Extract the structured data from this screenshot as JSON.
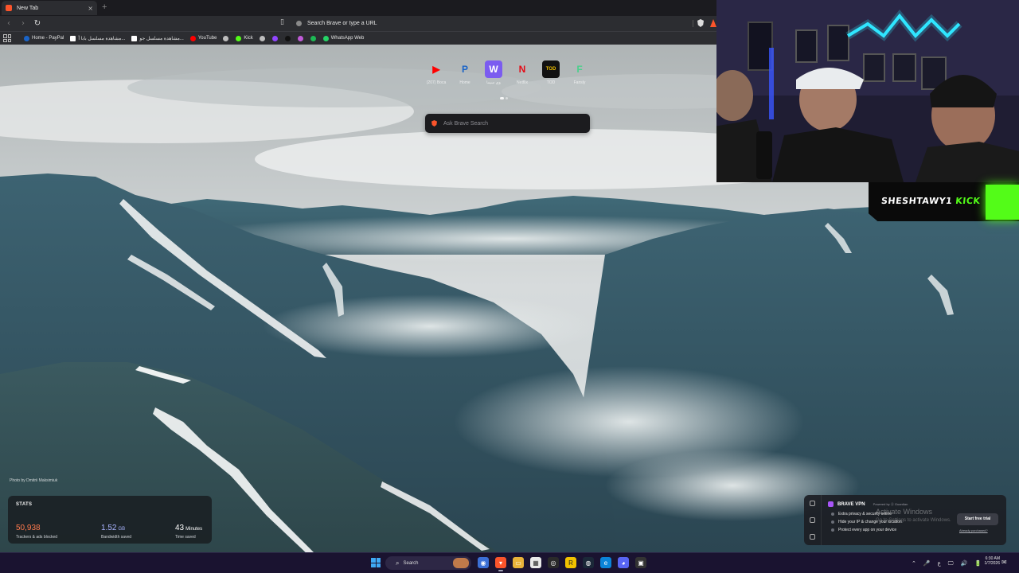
{
  "browser": {
    "tab_title": "New Tab",
    "tab_close": "×",
    "new_tab": "+",
    "back": "‹",
    "forward": "›",
    "reload": "↻",
    "bookmark_glyph": "▯",
    "omnibox_placeholder": "Search Brave or type a URL",
    "bookmarks": [
      {
        "label": "Home - PayPal",
        "icon": "paypal-icon",
        "color": "#1a64c8"
      },
      {
        "label": "مشاهدة مسلسل بابا أ...",
        "icon": "page-icon",
        "color": "#ffffff"
      },
      {
        "label": "مشاهدة مسلسل جو...",
        "icon": "page-icon",
        "color": "#ffffff"
      },
      {
        "label": "YouTube",
        "icon": "youtube-icon",
        "color": "#ff0000"
      },
      {
        "label": "",
        "icon": "globe-icon",
        "color": "#bdbdbd"
      },
      {
        "label": "Kick",
        "icon": "kick-icon",
        "color": "#53fc18"
      },
      {
        "label": "",
        "icon": "globe-icon",
        "color": "#bdbdbd"
      },
      {
        "label": "",
        "icon": "twitch-icon",
        "color": "#9146ff"
      },
      {
        "label": "",
        "icon": "tiktok-icon",
        "color": "#111111"
      },
      {
        "label": "",
        "icon": "app-icon",
        "color": "#c05bd8"
      },
      {
        "label": "",
        "icon": "spotify-icon",
        "color": "#1db954"
      },
      {
        "label": "WhatsApp Web",
        "icon": "whatsapp-icon",
        "color": "#25d366"
      }
    ]
  },
  "ntp": {
    "top_sites": [
      {
        "name": "(207) Boca",
        "glyph": "▶",
        "bg": "transparent",
        "fg": "#ff0000",
        "icon": "youtube-icon"
      },
      {
        "name": "Home",
        "glyph": "P",
        "bg": "transparent",
        "fg": "#1a64c8",
        "icon": "paypal-icon"
      },
      {
        "name": "وي سيما",
        "glyph": "W",
        "bg": "#7b5cf0",
        "fg": "#ffffff",
        "icon": "wecima-icon"
      },
      {
        "name": "Netflix",
        "glyph": "N",
        "bg": "transparent",
        "fg": "#e50914",
        "icon": "netflix-icon"
      },
      {
        "name": "TOD",
        "glyph": "TOD",
        "bg": "#111111",
        "fg": "#f2c200",
        "icon": "tod-icon"
      },
      {
        "name": "Fansly",
        "glyph": "F",
        "bg": "transparent",
        "fg": "#4ccf8c",
        "icon": "fansly-icon"
      }
    ],
    "search_placeholder": "Ask Brave Search",
    "photo_credit": "Photo by Dmitrii Maksimiuk",
    "stats": {
      "title": "STATS",
      "trackers_value": "50,938",
      "trackers_label": "Trackers & ads blocked",
      "bandwidth_value": "1.52",
      "bandwidth_unit": "GB",
      "bandwidth_label": "Bandwidth saved",
      "time_value": "43",
      "time_unit": "Minutes",
      "time_label": "Time saved",
      "colors": {
        "trackers": "#ff7a4d",
        "bandwidth": "#a9b4ff",
        "time": "#ffffff"
      }
    },
    "vpn": {
      "name": "BRAVE VPN",
      "powered_by": "Powered by ⓖ Guardian",
      "features": [
        "Extra privacy & security online",
        "Hide your IP & change your location",
        "Protect every app on your device"
      ],
      "cta": "Start free trial",
      "already": "Already purchased?"
    },
    "watermark": {
      "line1": "Activate Windows",
      "line2": "Go to Settings to activate Windows."
    }
  },
  "overlay": {
    "streamer": "SHESHTAWY1",
    "platform": "KICK",
    "accent": "#53fc18"
  },
  "taskbar": {
    "search_label": "Search",
    "clock_time": "6:30 AM",
    "clock_date": "1/7/2026",
    "tray": [
      "⌃",
      "🎤",
      "ع",
      "🖵",
      "🔊",
      "🔋"
    ]
  }
}
